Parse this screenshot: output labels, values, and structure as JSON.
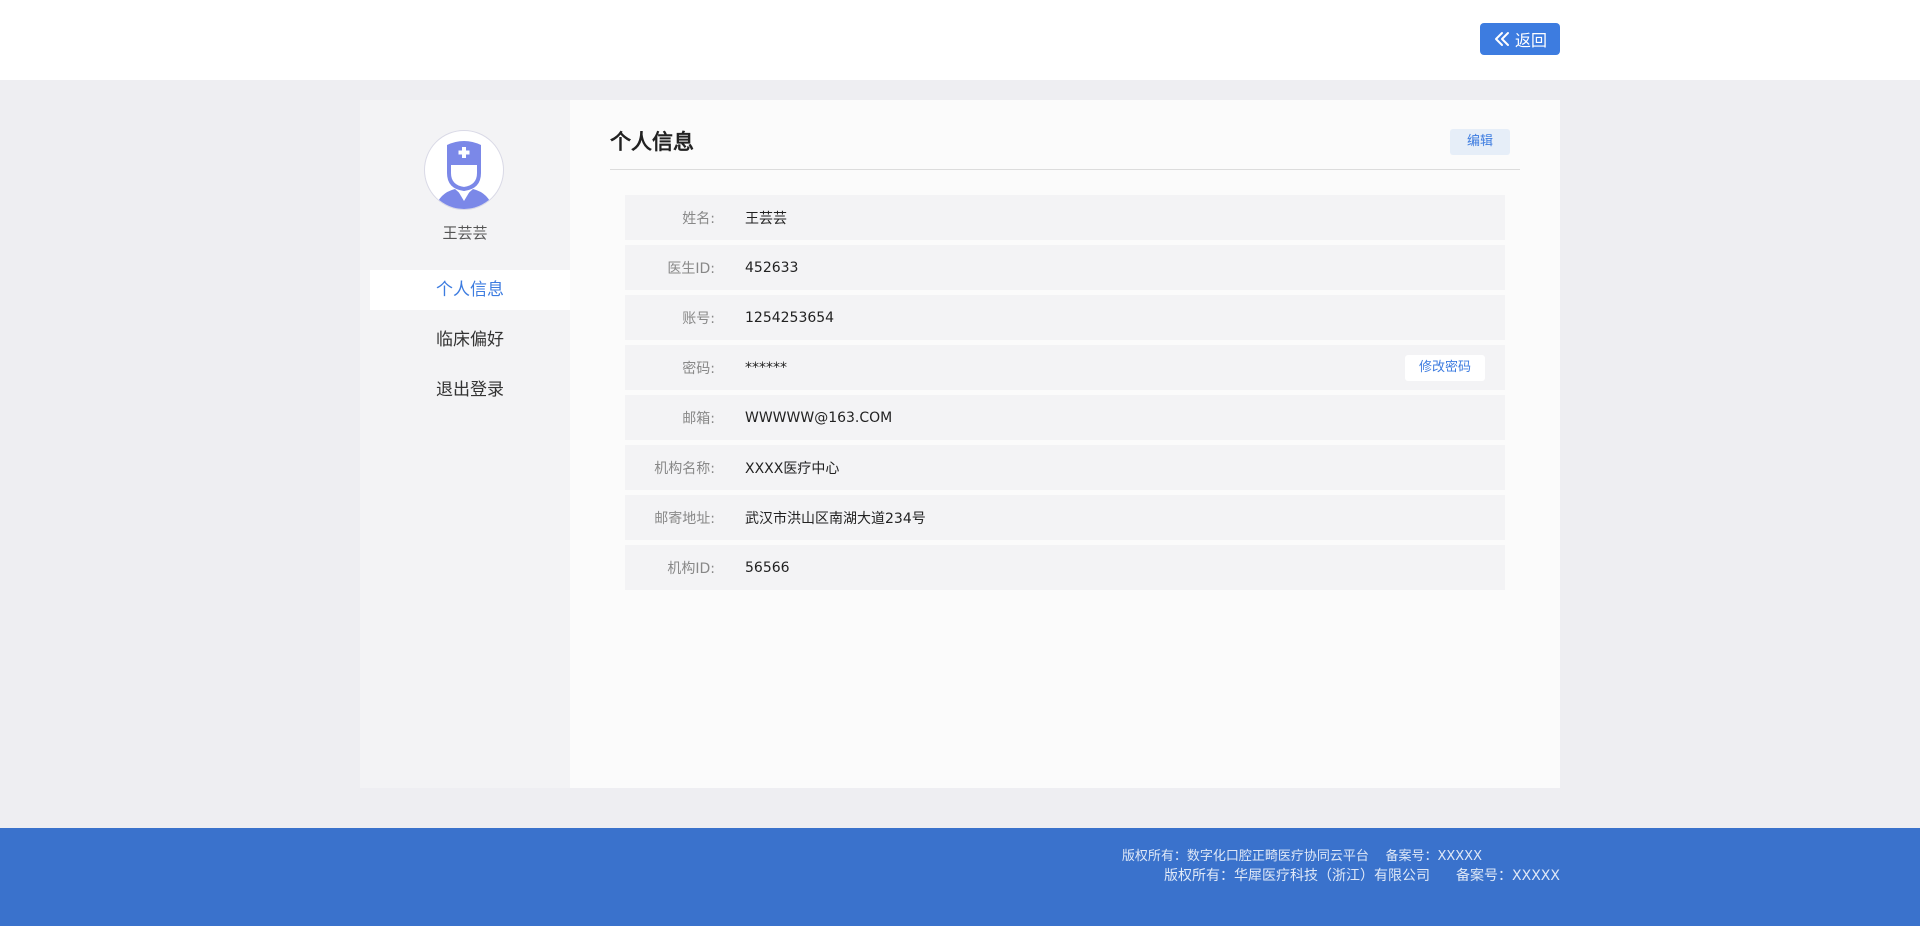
{
  "header": {
    "back_label": "返回"
  },
  "sidebar": {
    "username": "王芸芸",
    "items": [
      {
        "label": "个人信息"
      },
      {
        "label": "临床偏好"
      },
      {
        "label": "退出登录"
      }
    ]
  },
  "main": {
    "title": "个人信息",
    "edit_label": "编辑",
    "change_password_label": "修改密码",
    "fields": [
      {
        "label": "姓名:",
        "value": "王芸芸"
      },
      {
        "label": "医生ID:",
        "value": "452633"
      },
      {
        "label": "账号:",
        "value": "1254253654"
      },
      {
        "label": "密码:",
        "value": "******"
      },
      {
        "label": "邮箱:",
        "value": "WWWWW@163.COM"
      },
      {
        "label": "机构名称:",
        "value": "XXXX医疗中心"
      },
      {
        "label": "邮寄地址:",
        "value": "武汉市洪山区南湖大道234号"
      },
      {
        "label": "机构ID:",
        "value": "56566"
      }
    ]
  },
  "footer": {
    "line1_copyright": "版权所有：数字化口腔正畸医疗协同云平台",
    "line1_record": "备案号：XXXXX",
    "line2_copyright": "版权所有：华犀医疗科技（浙江）有限公司",
    "line2_record": "备案号：XXXXX"
  },
  "colors": {
    "accent": "#3d7ce0",
    "footer_bg": "#3a72cc",
    "avatar_icon": "#7b88e8"
  }
}
